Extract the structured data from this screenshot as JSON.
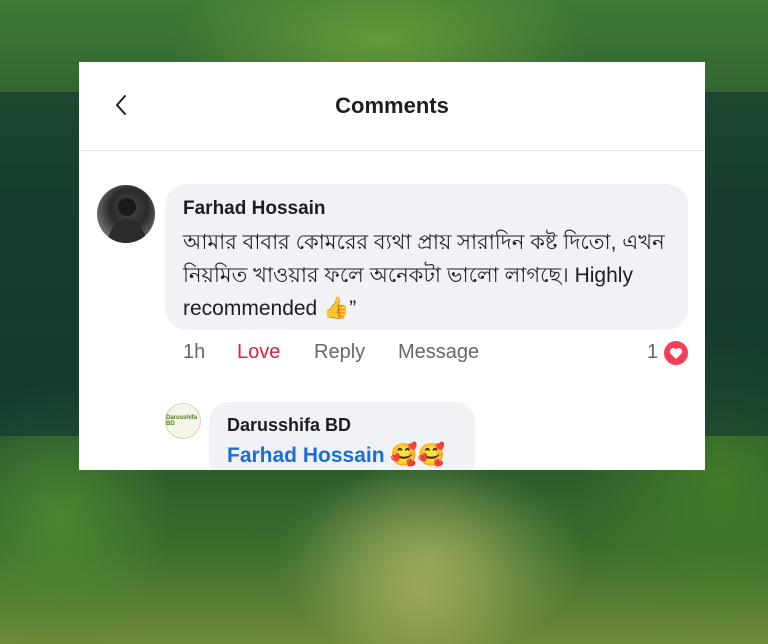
{
  "header": {
    "title": "Comments"
  },
  "comment": {
    "author": "Farhad Hossain",
    "text": "আমার বাবার কোমরের ব্যথা প্রায় সারাদিন কষ্ট দিতো, এখন নিয়মিত খাওয়ার ফলে অনেকটা ভালো লাগছে। Highly recommended 👍”",
    "time": "1h",
    "love_label": "Love",
    "reply_label": "Reply",
    "message_label": "Message",
    "reaction_count": "1"
  },
  "reply": {
    "author": "Darusshifa BD",
    "mention": "Farhad Hossain",
    "emojis": "🥰🥰",
    "avatar_text": "Darusshifa BD"
  },
  "colors": {
    "love": "#e41e3f",
    "mention": "#1a6ed8",
    "heart": "#f33e58"
  }
}
